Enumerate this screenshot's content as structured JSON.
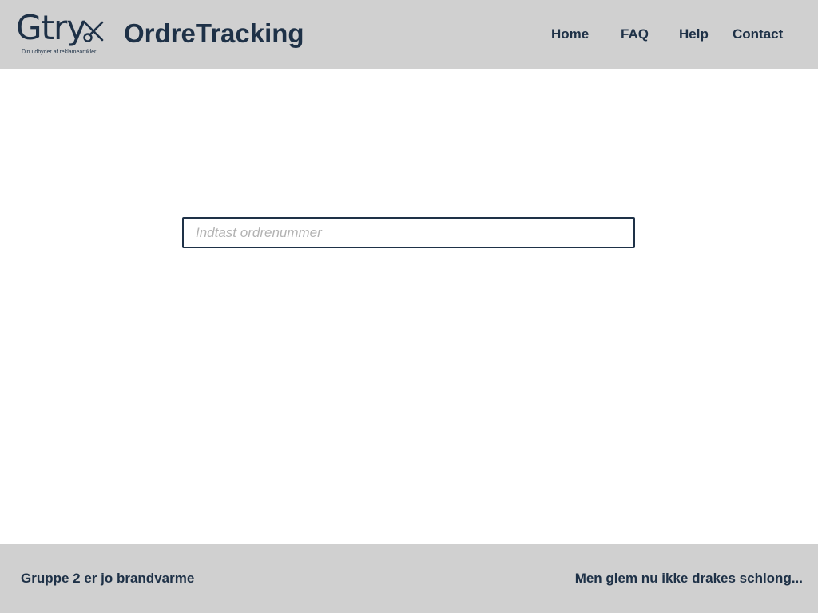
{
  "header": {
    "logo": {
      "word": "Gtry",
      "icon": "scissors-icon",
      "tagline": "Din udbyder af reklameartikler"
    },
    "title": "OrdreTracking",
    "nav": [
      {
        "label": "Home"
      },
      {
        "label": "FAQ"
      },
      {
        "label": "Help"
      },
      {
        "label": "Contact"
      }
    ]
  },
  "main": {
    "search": {
      "placeholder": "Indtast ordrenummer",
      "value": ""
    }
  },
  "footer": {
    "left_text": "Gruppe 2 er jo brandvarme",
    "right_text": "Men glem nu ikke drakes schlong..."
  },
  "colors": {
    "header_bg": "#d0d0d0",
    "footer_bg": "#d0d0d0",
    "text": "#1e3147",
    "input_border": "#1e3147",
    "placeholder": "#b3b3b3"
  }
}
